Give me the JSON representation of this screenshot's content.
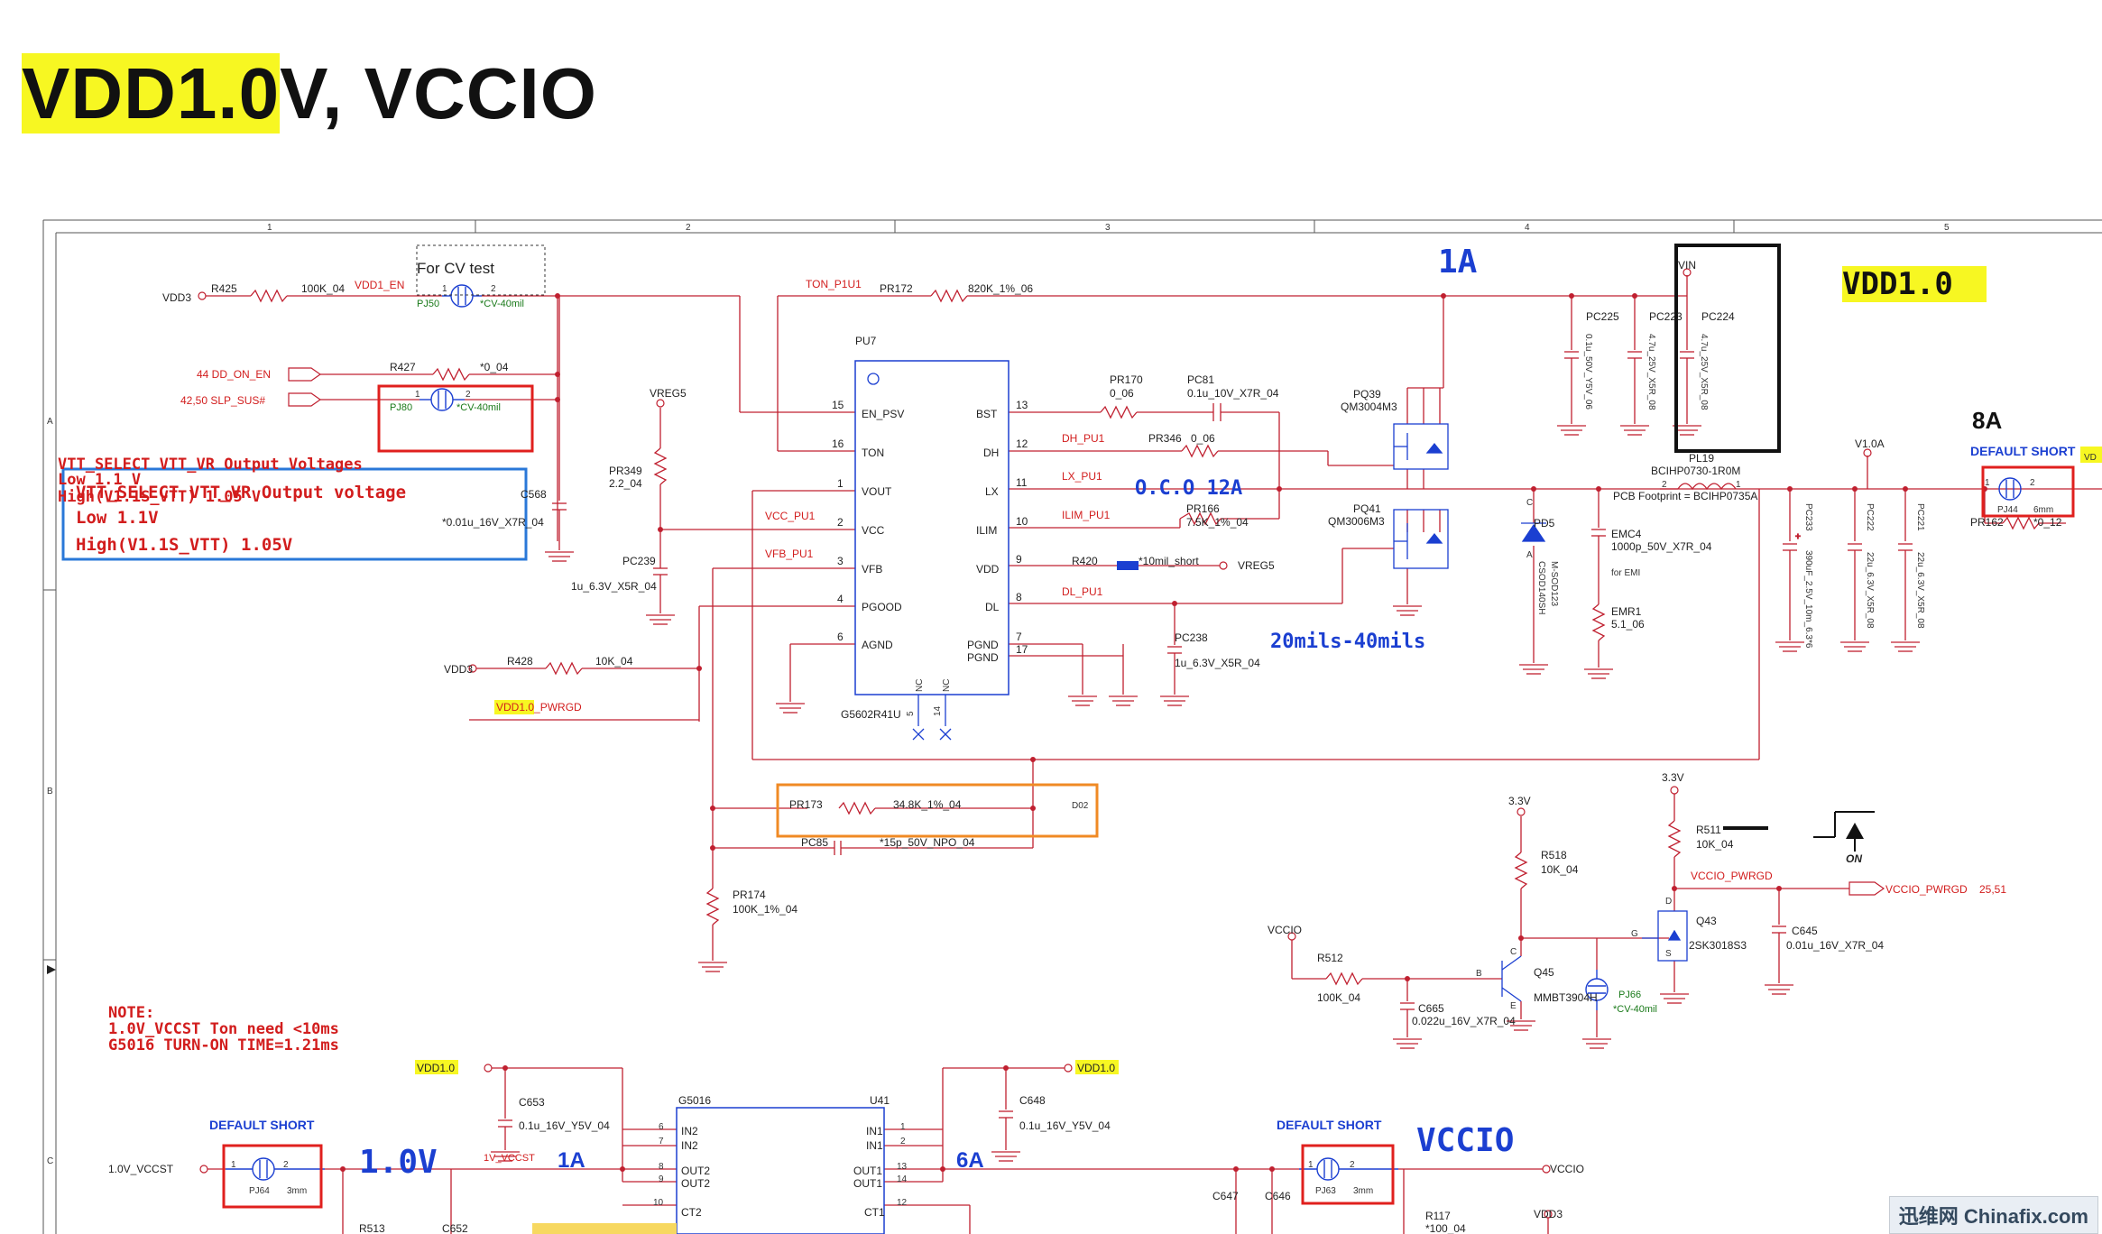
{
  "title": {
    "highlighted": "VDD1.0",
    "rest": "V, VCCIO"
  },
  "columns": [
    "1",
    "2",
    "3",
    "4",
    "5"
  ],
  "rows": [
    "A",
    "B",
    "C"
  ],
  "main_ic": {
    "ref": "PU7",
    "part": "G5602R41U",
    "pins_left": [
      {
        "num": "15",
        "name": "EN_PSV"
      },
      {
        "num": "16",
        "name": "TON"
      },
      {
        "num": "1",
        "name": "VOUT"
      },
      {
        "num": "2",
        "name": "VCC"
      },
      {
        "num": "3",
        "name": "VFB"
      },
      {
        "num": "4",
        "name": "PGOOD"
      },
      {
        "num": "6",
        "name": "AGND"
      }
    ],
    "pins_right": [
      {
        "num": "13",
        "name": "BST"
      },
      {
        "num": "12",
        "name": "DH"
      },
      {
        "num": "11",
        "name": "LX"
      },
      {
        "num": "10",
        "name": "ILIM"
      },
      {
        "num": "9",
        "name": "VDD"
      },
      {
        "num": "8",
        "name": "DL"
      },
      {
        "num": "7",
        "name": "PGND"
      },
      {
        "num": "17",
        "name": "PGND"
      }
    ],
    "pins_bottom": [
      {
        "num": "5",
        "name": "NC"
      },
      {
        "num": "14",
        "name": "NC"
      }
    ]
  },
  "labels": {
    "for_cv_test": "For CV test",
    "vdd3": "VDD3",
    "r425": "R425",
    "r425_val": "100K_04",
    "vdd1_en": "VDD1_EN",
    "pj50": "PJ50",
    "cv40": "*CV-40mil",
    "dd_on_en": "44  DD_ON_EN",
    "slp_sus": "42,50  SLP_SUS#",
    "r427": "R427",
    "r427_val": "*0_04",
    "pj80": "PJ80",
    "ton_p1u1": "TON_P1U1",
    "pr172": "PR172",
    "pr172_val": "820K_1%_06",
    "vreg5": "VREG5",
    "pr349": "PR349",
    "pr349_val": "2.2_04",
    "c568": "C568",
    "c568_val": "*0.01u_16V_X7R_04",
    "pc239": "PC239",
    "pc239_val": "1u_6.3V_X5R_04",
    "vcc_pu1": "VCC_PU1",
    "vfb_pu1": "VFB_PU1",
    "r428": "R428",
    "r428_val": "10K_04",
    "pwrgd": "VDD1.0_PWRGD",
    "pr170": "PR170",
    "pr170_val": "0_06",
    "pc81": "PC81",
    "pc81_val": "0.1u_10V_X7R_04",
    "dh_pu1": "DH_PU1",
    "pr346": "PR346",
    "pr346_val": "0_06",
    "lx_pu1": "LX_PU1",
    "ilim_pu1": "ILIM_PU1",
    "pr166": "PR166",
    "pr166_val": "7.5K_1%_04",
    "r420": "R420",
    "r420_val": "*10mil_short",
    "dl_pu1": "DL_PU1",
    "pc238": "PC238",
    "pc238_val": "1u_6.3V_X5R_04",
    "pq39": "PQ39",
    "pq39_val": "QM3004M3",
    "pq41": "PQ41",
    "pq41_val": "QM3006M3",
    "ocp": "O.C.O 12A",
    "mils": "20mils-40mils",
    "one_a": "1A",
    "vin": "VIN",
    "pc225": "PC225",
    "pc225_val": "0.1u_50V_Y5V_06",
    "pc223": "PC223",
    "pc223_val": "4.7u_25V_X5R_08",
    "pc224": "PC224",
    "pc224_val": "4.7u_25V_X5R_08",
    "pl19": "PL19",
    "pl19_val": "BCIHP0730-1R0M",
    "pcb_fp": "PCB Footprint = BCIHP0735A",
    "pd5": "PD5",
    "pd5_val": "CSOD140SH",
    "pd5_pkg": "M-SOD123",
    "emc4": "EMC4",
    "emc4_val": "1000p_50V_X7R_04",
    "for_emi": "for EMI",
    "emr1": "EMR1",
    "emr1_val": "5.1_06",
    "pc233": "PC233",
    "pc233_val": "390uF_2.5V_10m_6.3*6",
    "pc222": "PC222",
    "pc222_val": "22u_6.3V_X5R_08",
    "pc221": "PC221",
    "pc221_val": "22u_6.3V_X5R_08",
    "v1_0a": "V1.0A",
    "vdd1_0": "VDD1.0",
    "eight_a": "8A",
    "default_short": "DEFAULT  SHORT",
    "pj44": "PJ44",
    "pj44_val": "6mm",
    "pr162": "PR162",
    "pr162_val": "*0_12",
    "vd_cut": "VD",
    "pr173": "PR173",
    "pr173_val": "34.8K_1%_04",
    "d02": "D02",
    "pc85": "PC85",
    "pc85_val": "*15p_50V_NPO_04",
    "pr174": "PR174",
    "pr174_val": "100K_1%_04",
    "v33": "3.3V",
    "r518": "R518",
    "r518_val": "10K_04",
    "r511": "R511",
    "r511_val": "10K_04",
    "vccio_pwrgd": "VCCIO_PWRGD",
    "vccio_pwrgd_pages": "25,51",
    "q43": "Q43",
    "q43_val": "2SK3018S3",
    "q45": "Q45",
    "q45_val": "MMBT3904H",
    "vccio": "VCCIO",
    "r512": "R512",
    "r512_val": "100K_04",
    "c665": "C665",
    "c665_val": "0.022u_16V_X7R_04",
    "pj66": "PJ66",
    "pj66_val": "*CV-40mil",
    "c645": "C645",
    "c645_val": "0.01u_16V_X7R_04",
    "on": "ON",
    "vtt_header": "VTT_SELECT          VTT_VR  Output Voltages",
    "vtt_low": "Low                  1.1 V",
    "vtt_high": "High(V1.1S_VTT)     1.05 V",
    "vtt_header2": "VTT_SELECT       VTT_VR   Output voltage",
    "vtt_low2": "Low             1.1V",
    "vtt_high2": "High(V1.1S_VTT)   1.05V",
    "note1": "NOTE:",
    "note2": "1.0V_VCCST Ton need  <10ms",
    "note3": "G5016 TURN-ON TIME=1.21ms",
    "vdd10_label": "VDD1.0",
    "c653": "C653",
    "c653_val": "0.1u_16V_Y5V_04",
    "c648": "C648",
    "c648_val": "0.1u_16V_Y5V_04",
    "g5016": "G5016",
    "u41": "U41",
    "in2": "IN2",
    "in1": "IN1",
    "out2": "OUT2",
    "out1": "OUT1",
    "ct2": "CT2",
    "ct1": "CT1",
    "vccst": "1.0V_VCCST",
    "pj64": "PJ64",
    "pj64_val": "3mm",
    "one_0v": "1.0V",
    "one_a2": "1A",
    "six_a": "6A",
    "v1_vccst": "1V_VCCST",
    "pj63": "PJ63",
    "pj63_val": "3mm",
    "vccio_big": "VCCIO",
    "r513": "R513",
    "c652": "C652",
    "c647": "C647",
    "c646": "C646",
    "r117": "R117",
    "r117_val": "*100_04",
    "vdd3b": "VDD3"
  },
  "watermark": "迅维网 Chinafix.com",
  "colors": {
    "wire": "#c02030",
    "highlight": "#f7f722",
    "blue": "#1b3fd1",
    "red_box": "#e0201e",
    "blue_box": "#2a78d8",
    "orange_box": "#f08a24"
  }
}
